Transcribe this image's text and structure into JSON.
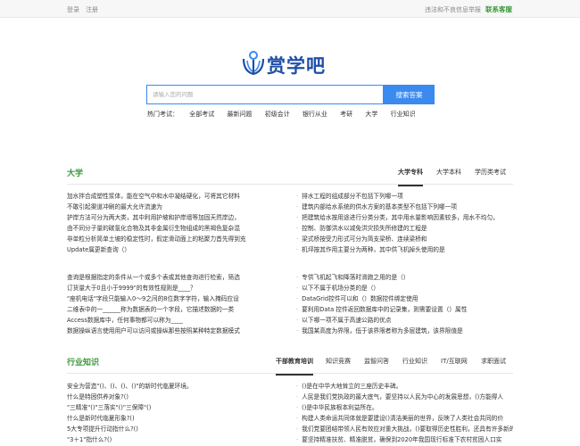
{
  "topbar": {
    "login": "登录",
    "register": "注册",
    "report": "违法和不良信息举报",
    "contact": "联系客服"
  },
  "logo": {
    "text": "赏学吧",
    "icon": "book-person-logo-icon"
  },
  "search": {
    "placeholder": "请输入您的问题",
    "button": "搜索答案"
  },
  "hot": {
    "label": "热门考试：",
    "tags": [
      "全部考试",
      "最新问题",
      "初级会计",
      "银行从业",
      "考研",
      "大学",
      "行业知识"
    ]
  },
  "colors": {
    "accent_green": "#3a9a3a",
    "accent_blue": "#3b8af0",
    "logo_blue": "#1f4fa8"
  },
  "daxue": {
    "title": "大学",
    "tabs": [
      "大学专科",
      "大学本科",
      "学历类考试"
    ],
    "left_block1": [
      "加水拌合成塑性浆体，能在空气中和水中凝结硬化，可将其它材料",
      "不敢引起渠道冲刷的最大允许流速为",
      "护岸方法可分为两大类，其中利用护坡和护岸墙等加固天然岸边，",
      "由不同分子量的碳氢化合物及其非金属衍生物组成的黑褐色复杂混",
      "非单粒分析简单土坡的稳定性时，假定滑动面上的粘聚力首先得到充",
      "Update属更新查询（）"
    ],
    "left_block2": [
      "查询是根据指定的条件从一个或多个表或其他查询进行检索，筛选",
      "订货量大于0且小于9999\"的有效性规则是____？",
      "\"座机电话\"字段只能输入0～9之间的8位数字字符，输入掩码应设",
      "二维表中的一______称为数据表的一个字段，它描述数据的一类",
      "Access数据库中，任何事物都可以称为____",
      "数据操纵语言使用用户可以访问或操纵那些按照某种特定数据模式"
    ],
    "right_block1": [
      "排水工程的组成部分不包括下列哪一项",
      "建筑内部给水系统的供水方案的基本类型不包括下列哪一项",
      "把建筑给水按用途进行分类分类，其中用水量影响因素较多，用水不均匀，",
      "控制、防御洪水以减免洪灾损失所修建的工程是",
      "梁式桥按受力形式可分为简支梁桥、连续梁桥和",
      "机坪按其作用主要分为两种，其中供飞机掉头使用的是"
    ],
    "right_block2": [
      "专供飞机起飞和降落时滑跑之用的是（）",
      "以下不属于机场分类的是（）",
      "DataGrid控件可以和（）数据控件绑定使用",
      "要利用Data 控件返回数据库中的记录集，则需要设置（）属性",
      "以下哪一项不属于高速公路的优点",
      "我国某高度为界限，低于该界限者称为多层建筑，该界限值是"
    ]
  },
  "hangye": {
    "title": "行业知识",
    "tabs": [
      "干部教育培训",
      "知识竞赛",
      "监智问答",
      "行业知识",
      "IT/互联网",
      "求职面试"
    ],
    "left_lines": [
      "安全为营造\"()、()、()、()\"的新时代临夏环境。",
      "什么是特困供养对象?()",
      "\"三精准\"()\"三落实\"()\"三保障\"()",
      "什么是新时代临夏形象?()",
      "5大专项提升行动指什么?()",
      "\"3＋1\"指什么?()"
    ],
    "right_lines": [
      "()是在中华大地耸立的三座历史丰碑。",
      "人民是我们党执政的最大底气，要坚持以人民为中心的发展思想，()方能得人",
      "()是中华民族根本利益所在。",
      "构建人类命运共同体就是要建设()清洁美丽的世界，反映了人类社会共同的价",
      "我们党要团结带领人民有效应对重大挑战，()要取得历史性胜利，还具有许多新的历史特点",
      "要坚持精准扶贫、精准脱贫，确保到2020年我国现行标准下农村贫困人口实"
    ]
  }
}
